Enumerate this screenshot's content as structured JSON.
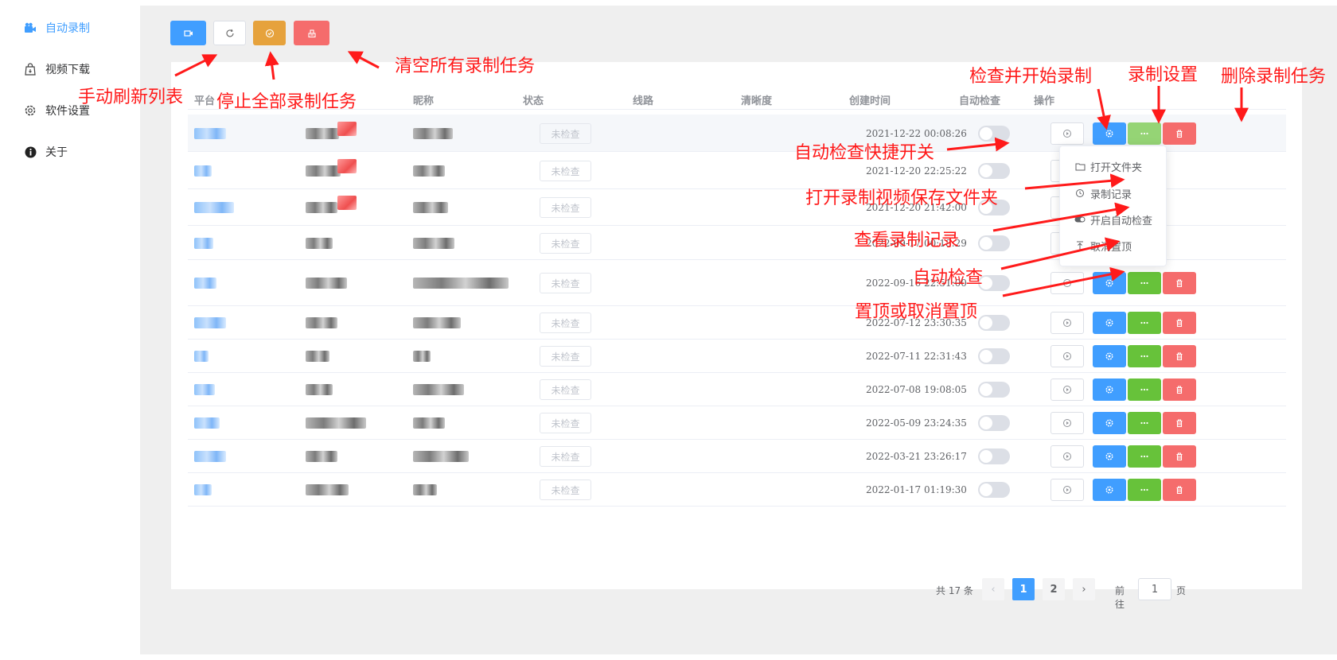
{
  "sidebar": {
    "items": [
      {
        "label": "自动录制",
        "icon": "camera-icon",
        "active": true
      },
      {
        "label": "视频下载",
        "icon": "bag-download-icon",
        "active": false
      },
      {
        "label": "软件设置",
        "icon": "gear-icon",
        "active": false
      },
      {
        "label": "关于",
        "icon": "info-icon",
        "active": false
      }
    ]
  },
  "toolbar": {
    "buttons": [
      {
        "icon": "video-add-icon",
        "color": "#409eff"
      },
      {
        "icon": "refresh-icon",
        "color": "#ffffff"
      },
      {
        "icon": "check-circle-icon",
        "color": "#e6a23c"
      },
      {
        "icon": "clear-icon",
        "color": "#f56c6c"
      }
    ]
  },
  "table": {
    "headers": {
      "platform": "平台",
      "nickname": "昵称",
      "status": "状态",
      "line": "线路",
      "quality": "清晰度",
      "created": "创建时间",
      "auto_check": "自动检查",
      "actions": "操作"
    },
    "status_text": "未检查",
    "rows": [
      {
        "created": "2021-12-22 00:08:26"
      },
      {
        "created": "2021-12-20 22:25:22"
      },
      {
        "created": "2021-12-20 21:42:00"
      },
      {
        "created": "2022-09-17 00:18:29"
      },
      {
        "created": "2022-09-16 22:51:00"
      },
      {
        "created": "2022-07-12 23:30:35"
      },
      {
        "created": "2022-07-11 22:31:43"
      },
      {
        "created": "2022-07-08 19:08:05"
      },
      {
        "created": "2022-05-09 23:24:35"
      },
      {
        "created": "2022-03-21 23:26:17"
      },
      {
        "created": "2022-01-17 01:19:30"
      }
    ]
  },
  "more_menu": {
    "items": [
      {
        "label": "打开文件夹",
        "icon": "folder-icon"
      },
      {
        "label": "录制记录",
        "icon": "history-icon"
      },
      {
        "label": "开启自动检查",
        "icon": "toggle-icon"
      },
      {
        "label": "取消置顶",
        "icon": "unpin-icon"
      }
    ]
  },
  "pagination": {
    "total": "共 17 条",
    "pages": [
      "1",
      "2"
    ],
    "current": "1",
    "goto_prefix": "前往",
    "goto_value": "1",
    "goto_suffix": "页"
  },
  "annotations": {
    "refresh": "手动刷新列表",
    "stop_all": "停止全部录制任务",
    "clear_all": "清空所有录制任务",
    "check_start": "检查并开始录制",
    "record_settings": "录制设置",
    "delete_task": "删除录制任务",
    "auto_toggle": "自动检查快捷开关",
    "open_folder": "打开录制视频保存文件夹",
    "view_records": "查看录制记录",
    "auto_check": "自动检查",
    "pin": "置顶或取消置顶"
  },
  "colors": {
    "primary": "#409eff",
    "success": "#67c23a",
    "warning": "#e6a23c",
    "danger": "#f56c6c",
    "annotation": "#ff1a1a"
  }
}
